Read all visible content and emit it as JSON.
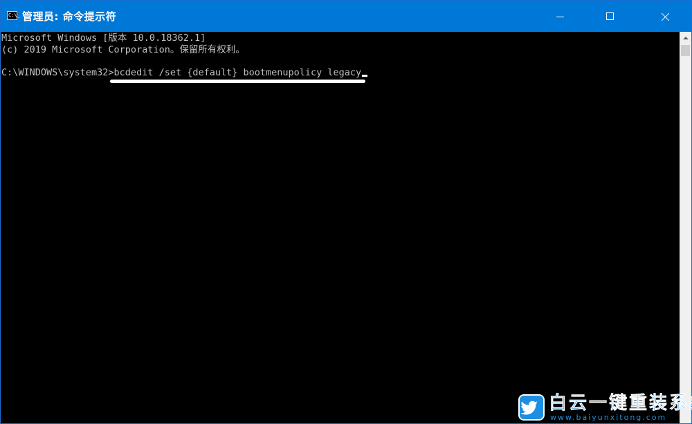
{
  "window": {
    "title": "管理员: 命令提示符",
    "icon": "cmd-console-icon",
    "icon_text": "C:\\_",
    "accent_color": "#0078d7",
    "controls": [
      "minimize",
      "maximize",
      "close"
    ]
  },
  "console": {
    "background": "#000000",
    "foreground": "#c0c0c0",
    "lines": [
      "Microsoft Windows [版本 10.0.18362.1]",
      "(c) 2019 Microsoft Corporation。保留所有权利。",
      "C:\\WINDOWS\\system32>bcdedit /set {default} bootmenupolicy legacy"
    ]
  },
  "watermark": {
    "title": "白云一键重装系统",
    "url": "www.baiyunxitong.com",
    "color": "#1d8fe0"
  }
}
